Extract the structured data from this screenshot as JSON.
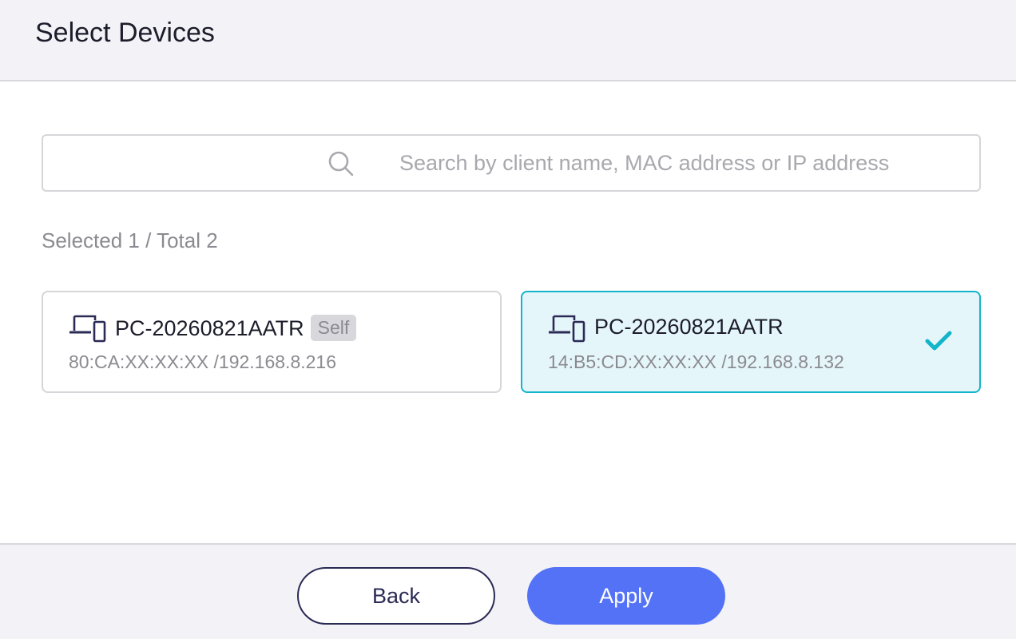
{
  "header": {
    "title": "Select Devices"
  },
  "search": {
    "placeholder": "Search by client name, MAC address or IP address",
    "value": "",
    "icon": "search-icon"
  },
  "selection": {
    "summary": "Selected 1 / Total 2"
  },
  "devices": [
    {
      "name": "PC-20260821AATR",
      "badge": "Self",
      "address": "80:CA:XX:XX:XX /192.168.8.216",
      "selected": false,
      "icon": "devices-icon"
    },
    {
      "name": "PC-20260821AATR",
      "badge": "",
      "address": "14:B5:CD:XX:XX:XX /192.168.8.132",
      "selected": true,
      "icon": "devices-icon"
    }
  ],
  "footer": {
    "back_label": "Back",
    "apply_label": "Apply"
  },
  "colors": {
    "accent": "#13b5cb",
    "primary_button": "#5472f5",
    "selected_bg": "#e5f6fa",
    "icon": "#2a2a55"
  }
}
